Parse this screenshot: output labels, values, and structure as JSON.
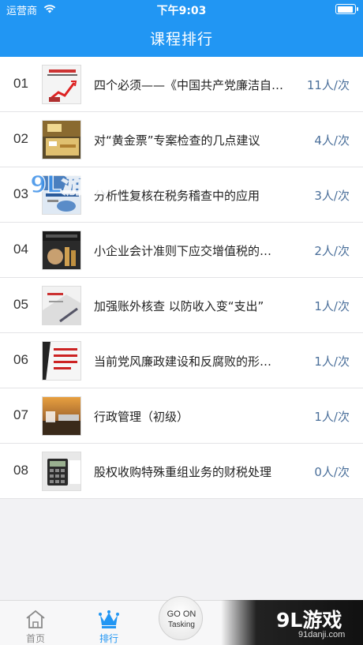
{
  "status": {
    "carrier": "运营商",
    "time": "下午9:03"
  },
  "nav": {
    "title": "课程排行"
  },
  "courses": [
    {
      "rank": "01",
      "title": "四个必须——《中国共产党廉洁自…",
      "count": "11人/次"
    },
    {
      "rank": "02",
      "title": "对“黄金票”专案检查的几点建议",
      "count": "4人/次"
    },
    {
      "rank": "03",
      "title": "分析性复核在税务稽查中的应用",
      "count": "3人/次"
    },
    {
      "rank": "04",
      "title": "小企业会计准则下应交增值税的…",
      "count": "2人/次"
    },
    {
      "rank": "05",
      "title": "加强账外核查 以防收入变“支出”",
      "count": "1人/次"
    },
    {
      "rank": "06",
      "title": "当前党风廉政建设和反腐败的形…",
      "count": "1人/次"
    },
    {
      "rank": "07",
      "title": "行政管理（初级）",
      "count": "1人/次"
    },
    {
      "rank": "08",
      "title": "股权收购特殊重组业务的财税处理",
      "count": "0人/次"
    }
  ],
  "tabbar": {
    "home": "首页",
    "rank": "排行",
    "goon_line1": "GO ON",
    "goon_line2": "Tasking"
  },
  "watermark": {
    "big": "9L游戏",
    "small": "91danji.com",
    "overlay": "9L游戏"
  },
  "colors": {
    "accent": "#2196f3",
    "count_text": "#4a6f9a"
  }
}
